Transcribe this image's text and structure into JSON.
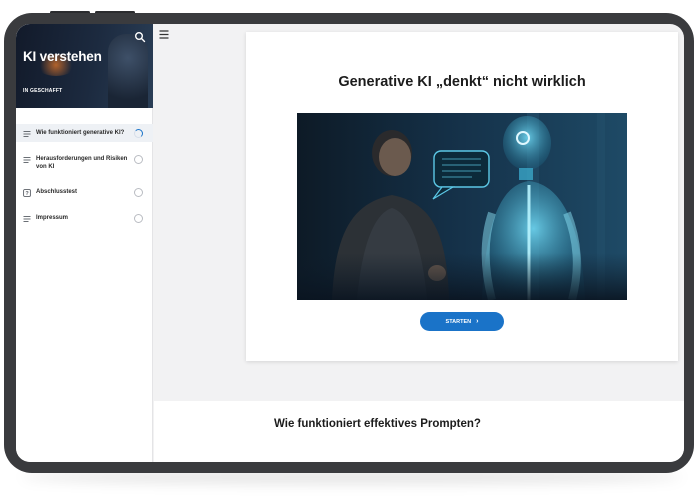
{
  "sidebar": {
    "course_title": "KI verstehen",
    "course_subtitle": "IN GESCHAFFT",
    "search_icon": "search-icon",
    "items": [
      {
        "label": "Wie funktioniert generative KI?",
        "icon": "list-icon",
        "status": "in-progress",
        "active": true
      },
      {
        "label": "Herausforderungen und Risiken von KI",
        "icon": "list-icon",
        "status": "not-started",
        "active": false
      },
      {
        "label": "Abschlusstest",
        "icon": "quiz-icon",
        "status": "not-started",
        "active": false
      },
      {
        "label": "Impressum",
        "icon": "list-icon",
        "status": "not-started",
        "active": false
      }
    ]
  },
  "main": {
    "menu_icon": "hamburger-icon",
    "card_title": "Generative KI „denkt“ nicht wirklich",
    "start_button": "STARTEN",
    "start_icon": "chevron-right-icon",
    "next_section_title": "Wie funktioniert effektives Prompten?"
  },
  "colors": {
    "accent": "#1a73c8",
    "tablet_frame": "#3a3b3e",
    "active_nav_bg": "#eef1f5"
  }
}
